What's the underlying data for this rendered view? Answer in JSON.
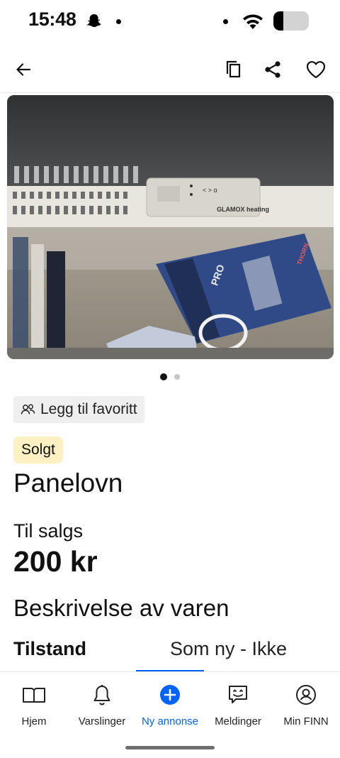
{
  "status_bar": {
    "time": "15:48",
    "battery_level": 0.28
  },
  "top_bar": {
    "icons": [
      "back-arrow-icon",
      "copy-icon",
      "share-icon",
      "heart-icon"
    ]
  },
  "gallery": {
    "photo_labels": [
      "GLAMOX heating",
      "PRO",
      "THORN"
    ],
    "current_index": 1,
    "total": 2
  },
  "listing": {
    "favorite_chip": "Legg til favoritt",
    "status_badge": "Solgt",
    "title": "Panelovn",
    "for_sale_label": "Til salgs",
    "price": "200 kr",
    "description_heading": "Beskrivelse av varen",
    "condition_label": "Tilstand",
    "condition_value": "Som ny - Ikke"
  },
  "bottom_nav": {
    "items": [
      {
        "label": "Hjem",
        "icon": "home-icon"
      },
      {
        "label": "Varslinger",
        "icon": "bell-icon"
      },
      {
        "label": "Ny annonse",
        "icon": "plus-circle-icon"
      },
      {
        "label": "Meldinger",
        "icon": "chat-icon"
      },
      {
        "label": "Min FINN",
        "icon": "profile-icon"
      }
    ],
    "active": "Ny annonse"
  },
  "colors": {
    "accent": "#0063fb",
    "sold_badge_bg": "#fdf0c3",
    "chip_bg": "#efefef"
  }
}
